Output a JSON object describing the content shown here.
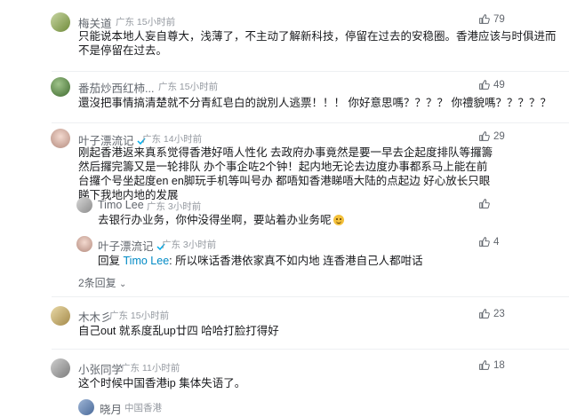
{
  "comments": [
    {
      "name": "梅关道",
      "location": "广东",
      "time": "15小时前",
      "likes": "79",
      "text": "只能说本地人妄自尊大，浅薄了，不主动了解新科技，停留在过去的安稳圈。香港应该与时俱进而不是停留在过去。"
    },
    {
      "name": "番茄炒西红柿...",
      "location": "广东",
      "time": "15小时前",
      "likes": "49",
      "text": "還沒把事情搞清楚就不分青紅皂白的說別人逃票！！！ 你好意思嗎？？？？ 你禮貌嗎？？？？？"
    },
    {
      "name": "叶子漂流记",
      "location": "广东",
      "time": "14小时前",
      "likes": "29",
      "text": "刚起香港返来真系觉得香港好唔人性化 去政府办事竟然是要一早去企起度排队等攞籌 然后攞完籌又是一轮排队 办个事企咗2个钟！起内地无论去边度办事都系马上能在前台攞个号坐起度en en脚玩手机等叫号办 都唔知香港睇唔大陆的点起边 好心放长只眼睇下我地内地的发展",
      "replies": [
        {
          "name": "Timo Lee",
          "location": "广东",
          "time": "3小时前",
          "likes": "",
          "text": "去银行办业务，你仲没得坐啊，要站着办业务呢"
        },
        {
          "name": "叶子漂流记",
          "location": "广东",
          "time": "3小时前",
          "likes": "4",
          "reply_prefix": "回复",
          "reply_to": "Timo Lee",
          "text": ": 所以咪话香港依家真不如内地 连香港自己人都咁话"
        }
      ],
      "more_replies": "2条回复"
    },
    {
      "name": "木木彡",
      "location": "广东",
      "time": "15小时前",
      "likes": "23",
      "text": "自己out 就系度乱up廿四 哈哈打脸打得好"
    },
    {
      "name": "小张同学",
      "location": "广东",
      "time": "11小时前",
      "likes": "18",
      "text": "这个时候中国香港ip 集体失语了。"
    },
    {
      "name": "晓月",
      "location": "中国香港",
      "time": "",
      "likes": "",
      "text": ""
    }
  ]
}
